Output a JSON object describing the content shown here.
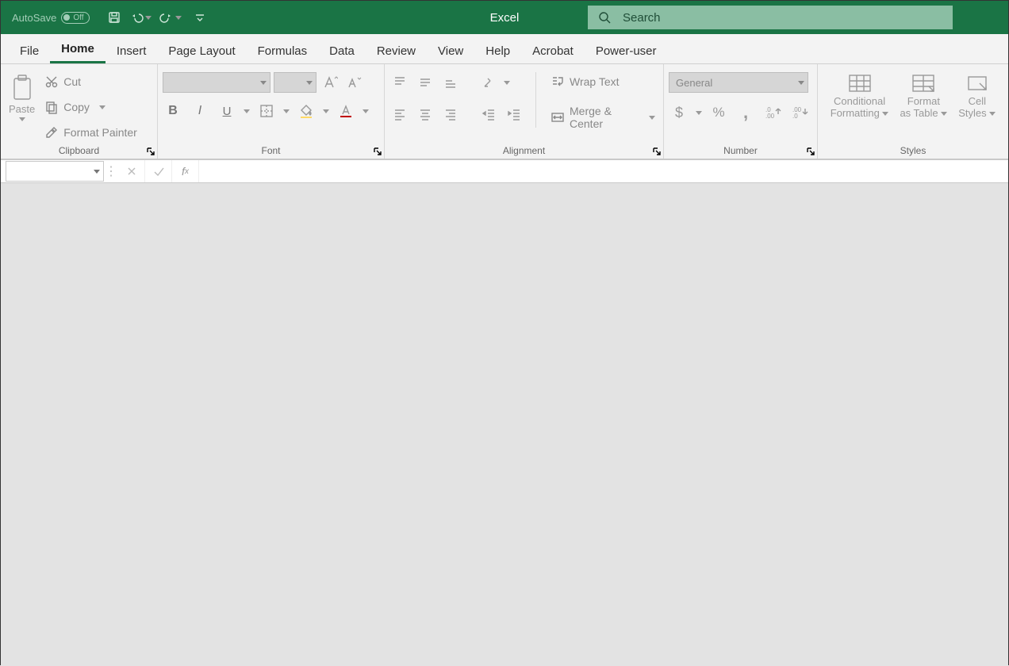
{
  "title_bar": {
    "autosave_label": "AutoSave",
    "autosave_state": "Off",
    "app_title": "Excel",
    "search_placeholder": "Search"
  },
  "tabs": [
    {
      "label": "File",
      "active": false
    },
    {
      "label": "Home",
      "active": true
    },
    {
      "label": "Insert",
      "active": false
    },
    {
      "label": "Page Layout",
      "active": false
    },
    {
      "label": "Formulas",
      "active": false
    },
    {
      "label": "Data",
      "active": false
    },
    {
      "label": "Review",
      "active": false
    },
    {
      "label": "View",
      "active": false
    },
    {
      "label": "Help",
      "active": false
    },
    {
      "label": "Acrobat",
      "active": false
    },
    {
      "label": "Power-user",
      "active": false
    }
  ],
  "ribbon": {
    "clipboard": {
      "label": "Clipboard",
      "paste": "Paste",
      "cut": "Cut",
      "copy": "Copy",
      "format_painter": "Format Painter"
    },
    "font": {
      "label": "Font",
      "font_name": "",
      "font_size": ""
    },
    "alignment": {
      "label": "Alignment",
      "wrap_text": "Wrap Text",
      "merge_center": "Merge & Center"
    },
    "number": {
      "label": "Number",
      "format": "General"
    },
    "styles": {
      "label": "Styles",
      "conditional": "Conditional Formatting",
      "format_table": "Format as Table",
      "cell_styles": "Cell Styles"
    }
  },
  "formula_bar": {
    "name_box_value": "",
    "formula_value": ""
  }
}
